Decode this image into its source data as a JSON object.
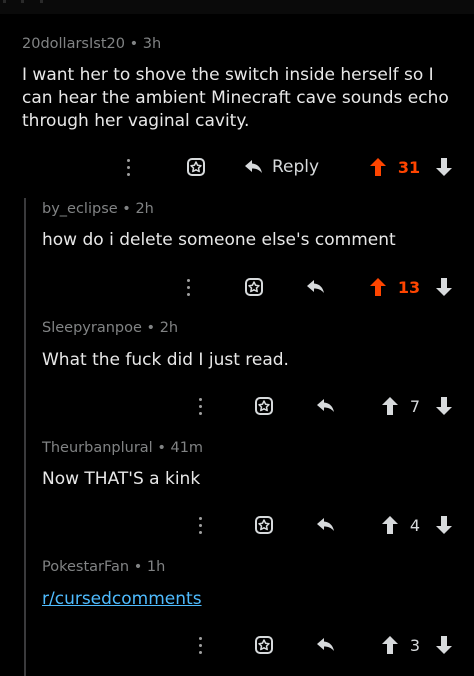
{
  "comments": [
    {
      "author": "20dollarsIst20",
      "sep": "•",
      "age": "3h",
      "text": "I want her to shove the switch inside herself so I can hear the ambient Minecraft cave sounds echo through her vaginal cavity.",
      "reply_label": "Reply",
      "score": "31",
      "upvoted": true
    },
    {
      "author": "by_eclipse",
      "sep": "•",
      "age": "2h",
      "text": "how do i delete someone else's comment",
      "score": "13",
      "upvoted": true
    },
    {
      "author": "Sleepyranpoe",
      "sep": "•",
      "age": "2h",
      "text": "What the fuck did I just read.",
      "score": "7",
      "upvoted": false
    },
    {
      "author": "Theurbanplural",
      "sep": "•",
      "age": "41m",
      "text": "Now THAT'S a kink",
      "score": "4",
      "upvoted": false
    },
    {
      "author": "PokestarFan",
      "sep": "•",
      "age": "1h",
      "link_text": "r/cursedcomments",
      "score": "3",
      "upvoted": false
    }
  ],
  "colors": {
    "upvote_active": "#ff4500",
    "link": "#4fbcff",
    "background": "#000000"
  },
  "icons": [
    "more-vertical-icon",
    "award-icon",
    "reply-arrow-icon",
    "upvote-arrow-icon",
    "downvote-arrow-icon"
  ]
}
